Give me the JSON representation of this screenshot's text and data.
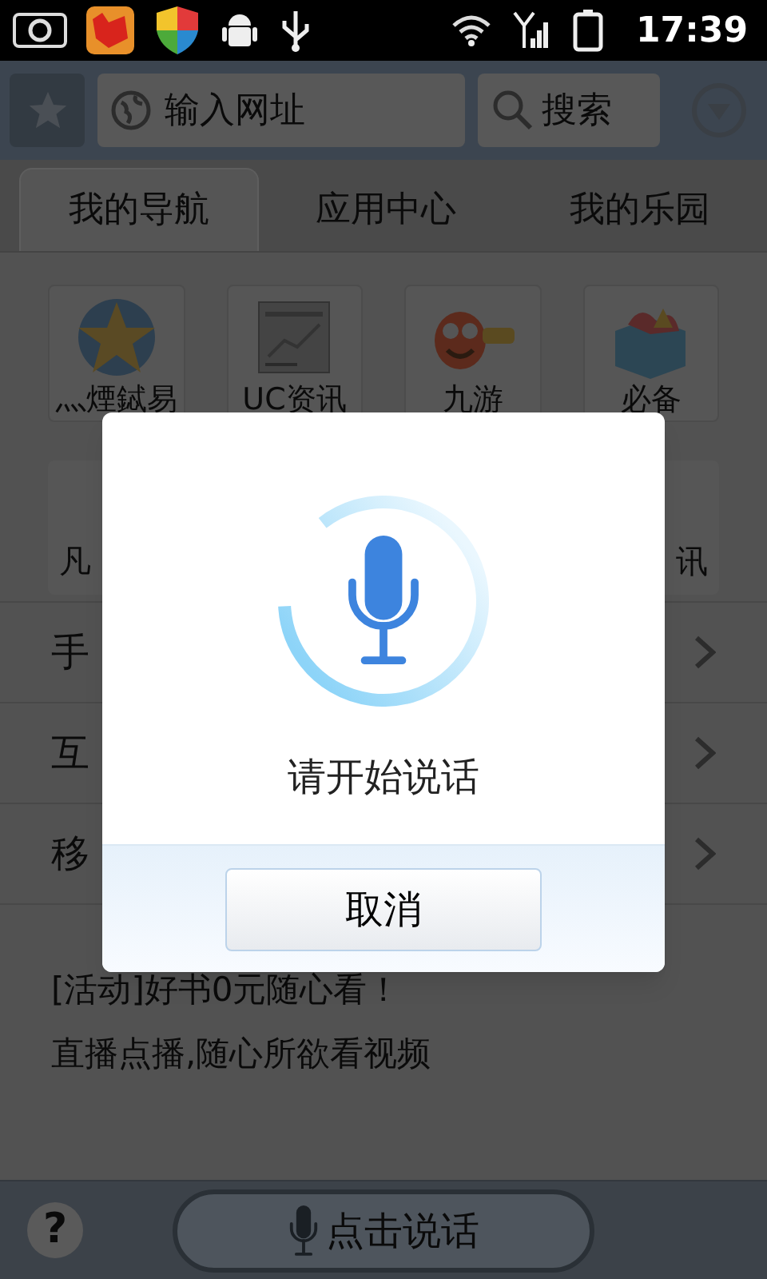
{
  "status_bar": {
    "time": "17:39"
  },
  "toolbar": {
    "address": {
      "placeholder": "输入网址"
    },
    "search": {
      "placeholder": "搜索"
    }
  },
  "tabs": [
    {
      "label": "我的导航",
      "selected": true
    },
    {
      "label": "应用中心",
      "selected": false
    },
    {
      "label": "我的乐园",
      "selected": false
    }
  ],
  "shortcuts": [
    {
      "label": "灬煙鋱易"
    },
    {
      "label": "UC资讯"
    },
    {
      "label": "九游"
    },
    {
      "label": "必备"
    }
  ],
  "shortcuts_row_2": {
    "left": "凡",
    "right": "讯"
  },
  "list_rows": [
    {
      "label": "手"
    },
    {
      "label": "互"
    },
    {
      "label": "移"
    }
  ],
  "news": [
    "[活动]好书0元随心看！",
    "直播点播,随心所欲看视频"
  ],
  "dialog": {
    "prompt": "请开始说话",
    "cancel": "取消"
  },
  "bottom_bar": {
    "help": "?",
    "speak": "点击说话"
  }
}
